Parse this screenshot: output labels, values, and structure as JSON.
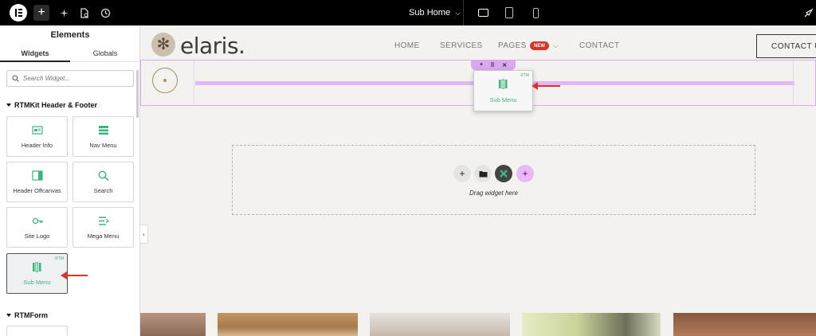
{
  "topbar": {
    "page_name": "Sub Home"
  },
  "panel": {
    "title": "Elements",
    "tabs": [
      {
        "label": "Widgets",
        "active": true
      },
      {
        "label": "Globals",
        "active": false
      }
    ],
    "search_placeholder": "Search Widget...",
    "sections": [
      {
        "title": "RTMKit Header & Footer"
      },
      {
        "title": "RTMForm"
      }
    ],
    "widgets": [
      {
        "label": "Header Info",
        "icon": "header-info-icon"
      },
      {
        "label": "Nav Menu",
        "icon": "nav-menu-icon"
      },
      {
        "label": "Header Offcanvas",
        "icon": "offcanvas-icon"
      },
      {
        "label": "Search",
        "icon": "search-icon"
      },
      {
        "label": "Site Logo",
        "icon": "site-logo-icon"
      },
      {
        "label": "Mega Menu",
        "icon": "mega-menu-icon"
      },
      {
        "label": "Sub Menu",
        "icon": "sub-menu-icon",
        "badge": "RTM"
      }
    ]
  },
  "site": {
    "brand": "elaris.",
    "nav": [
      "HOME",
      "SERVICES",
      "PAGES",
      "CONTACT"
    ],
    "new_badge": "NEW",
    "contact_button": "CONTACT US"
  },
  "drag_ghost": {
    "label": "Sub Menu",
    "badge": "RTM"
  },
  "drop_zone": {
    "text": "Drag widget here"
  },
  "colors": {
    "accent_green": "#3fb37f",
    "selection_purple": "#d9a8ee",
    "annotation_red": "#d9342b"
  }
}
